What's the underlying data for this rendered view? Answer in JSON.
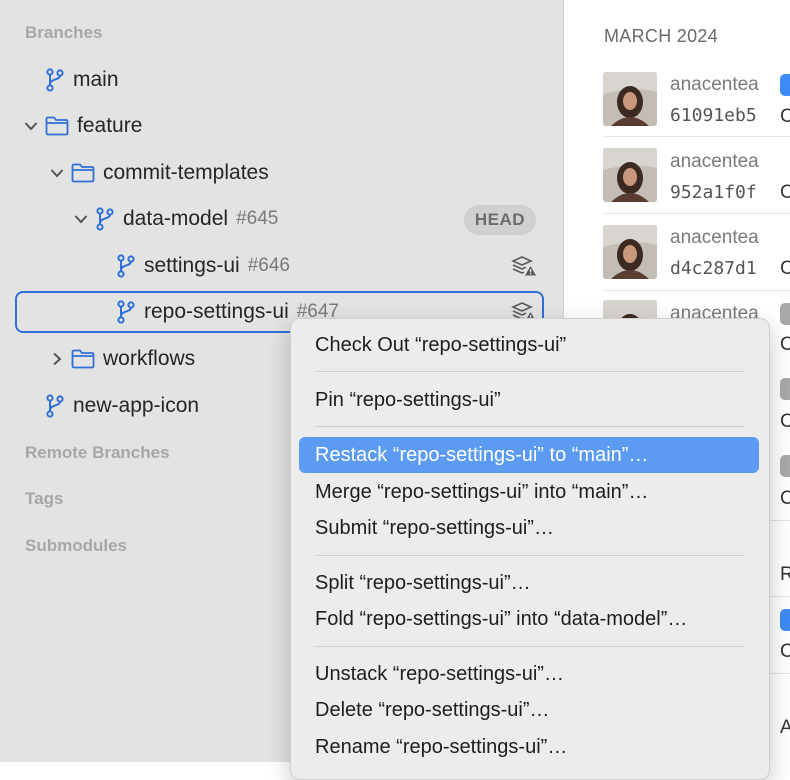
{
  "sidebar": {
    "branches_header": "Branches",
    "remote_header": "Remote Branches",
    "tags_header": "Tags",
    "submodules_header": "Submodules",
    "items": {
      "main": {
        "label": "main"
      },
      "feature": {
        "label": "feature"
      },
      "commit_templates": {
        "label": "commit-templates"
      },
      "data_model": {
        "label": "data-model",
        "number": "#645",
        "badge": "HEAD"
      },
      "settings_ui": {
        "label": "settings-ui",
        "number": "#646"
      },
      "repo_settings_ui": {
        "label": "repo-settings-ui",
        "number": "#647"
      },
      "workflows": {
        "label": "workflows"
      },
      "new_app_icon": {
        "label": "new-app-icon"
      }
    }
  },
  "history": {
    "month": "MARCH 2024",
    "commits": [
      {
        "author": "anacentea",
        "sha": "61091eb5",
        "msg_start": "C"
      },
      {
        "author": "anacentea",
        "sha": "952a1f0f",
        "msg_start": "C"
      },
      {
        "author": "anacentea",
        "sha": "d4c287d1",
        "msg_start": "C"
      },
      {
        "author": "anacentea"
      }
    ],
    "fragments": [
      "C",
      "C",
      "C",
      "R",
      "C",
      "A"
    ]
  },
  "context_menu": {
    "checkout": "Check Out “repo-settings-ui”",
    "pin": "Pin “repo-settings-ui”",
    "restack": "Restack “repo-settings-ui” to “main”…",
    "merge": "Merge “repo-settings-ui” into “main”…",
    "submit": "Submit “repo-settings-ui”…",
    "split": "Split “repo-settings-ui”…",
    "fold": "Fold “repo-settings-ui” into “data-model”…",
    "unstack": "Unstack “repo-settings-ui”…",
    "delete": "Delete “repo-settings-ui”…",
    "rename": "Rename “repo-settings-ui”…"
  },
  "colors": {
    "accent": "#2f6fd6",
    "highlight": "#5b9cf2",
    "sidebar_bg": "#e3e3e3"
  }
}
